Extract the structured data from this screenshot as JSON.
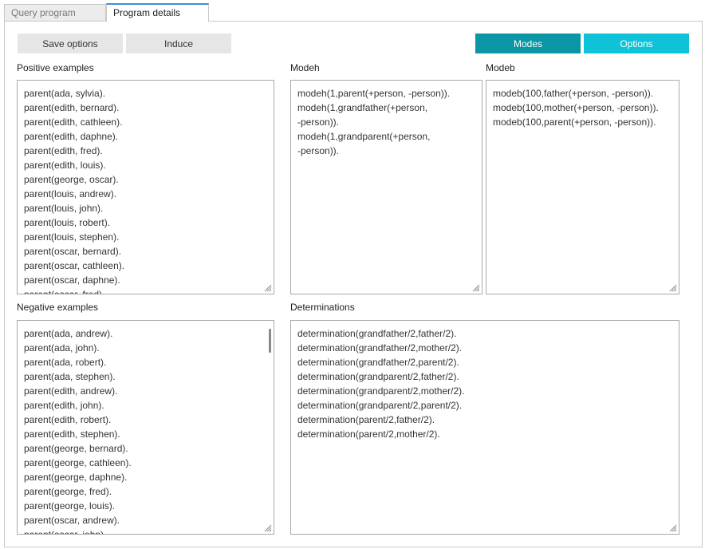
{
  "tabs": [
    {
      "label": "Query program",
      "active": false
    },
    {
      "label": "Program details",
      "active": true
    }
  ],
  "toolbar": {
    "save_options": "Save options",
    "induce": "Induce",
    "modes": "Modes",
    "options": "Options"
  },
  "colors": {
    "tab_accent": "#3b8fd6",
    "modes_button": "#0b96a6",
    "options_button": "#0ec3d8",
    "gray_button": "#e6e6e6"
  },
  "sections": {
    "positive": {
      "label": "Positive examples",
      "lines": [
        "parent(ada, sylvia).",
        "parent(edith, bernard).",
        "parent(edith, cathleen).",
        "parent(edith, daphne).",
        "parent(edith, fred).",
        "parent(edith, louis).",
        "parent(george, oscar).",
        "parent(louis, andrew).",
        "parent(louis, john).",
        "parent(louis, robert).",
        "parent(louis, stephen).",
        "parent(oscar, bernard).",
        "parent(oscar, cathleen).",
        "parent(oscar, daphne).",
        "parent(oscar, fred)."
      ]
    },
    "modeh": {
      "label": "Modeh",
      "lines": [
        "modeh(1,parent(+person, -person)).",
        "modeh(1,grandfather(+person,",
        "-person)).",
        "modeh(1,grandparent(+person,",
        "-person))."
      ]
    },
    "modeb": {
      "label": "Modeb",
      "lines": [
        "modeb(100,father(+person, -person)).",
        "modeb(100,mother(+person, -person)).",
        "modeb(100,parent(+person, -person))."
      ]
    },
    "negative": {
      "label": "Negative examples",
      "lines": [
        "parent(ada, andrew).",
        "parent(ada, john).",
        "parent(ada, robert).",
        "parent(ada, stephen).",
        "parent(edith, andrew).",
        "parent(edith, john).",
        "parent(edith, robert).",
        "parent(edith, stephen).",
        "parent(george, bernard).",
        "parent(george, cathleen).",
        "parent(george, daphne).",
        "parent(george, fred).",
        "parent(george, louis).",
        "parent(oscar, andrew).",
        "parent(oscar, john)."
      ]
    },
    "determinations": {
      "label": "Determinations",
      "lines": [
        "determination(grandfather/2,father/2).",
        "determination(grandfather/2,mother/2).",
        "determination(grandfather/2,parent/2).",
        "determination(grandparent/2,father/2).",
        "determination(grandparent/2,mother/2).",
        "determination(grandparent/2,parent/2).",
        "determination(parent/2,father/2).",
        "determination(parent/2,mother/2)."
      ]
    }
  }
}
